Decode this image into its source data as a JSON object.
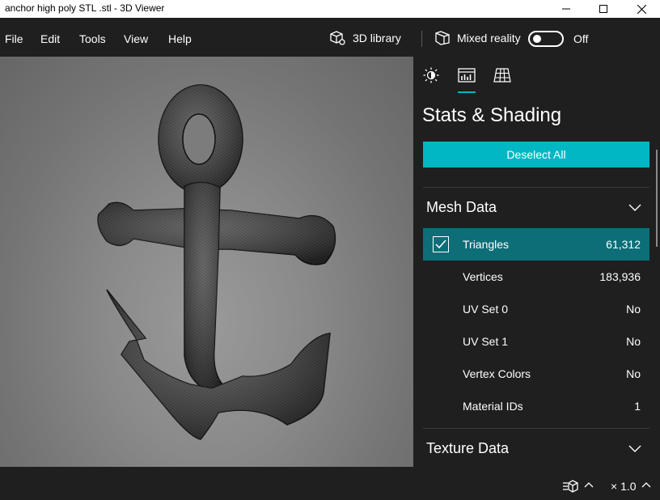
{
  "window": {
    "title": "anchor high poly STL .stl - 3D Viewer"
  },
  "menu": {
    "items": [
      "File",
      "Edit",
      "Tools",
      "View",
      "Help"
    ],
    "library_label": "3D library",
    "mixed_reality_label": "Mixed reality",
    "toggle_state": "Off"
  },
  "panel": {
    "tabs": [
      "lighting-icon",
      "stats-icon",
      "grid-icon"
    ],
    "active_tab": 1,
    "title": "Stats & Shading",
    "deselect_label": "Deselect All",
    "mesh_section": "Mesh Data",
    "texture_section": "Texture Data",
    "rows": [
      {
        "label": "Triangles",
        "value": "61,312",
        "selected": true,
        "checked": true
      },
      {
        "label": "Vertices",
        "value": "183,936"
      },
      {
        "label": "UV Set 0",
        "value": "No"
      },
      {
        "label": "UV Set 1",
        "value": "No"
      },
      {
        "label": "Vertex Colors",
        "value": "No"
      },
      {
        "label": "Material IDs",
        "value": "1"
      }
    ]
  },
  "status": {
    "zoom": "× 1.0"
  },
  "colors": {
    "accent": "#00b7c3",
    "selected_row": "#0d6e78",
    "background": "#1f1f1f"
  }
}
